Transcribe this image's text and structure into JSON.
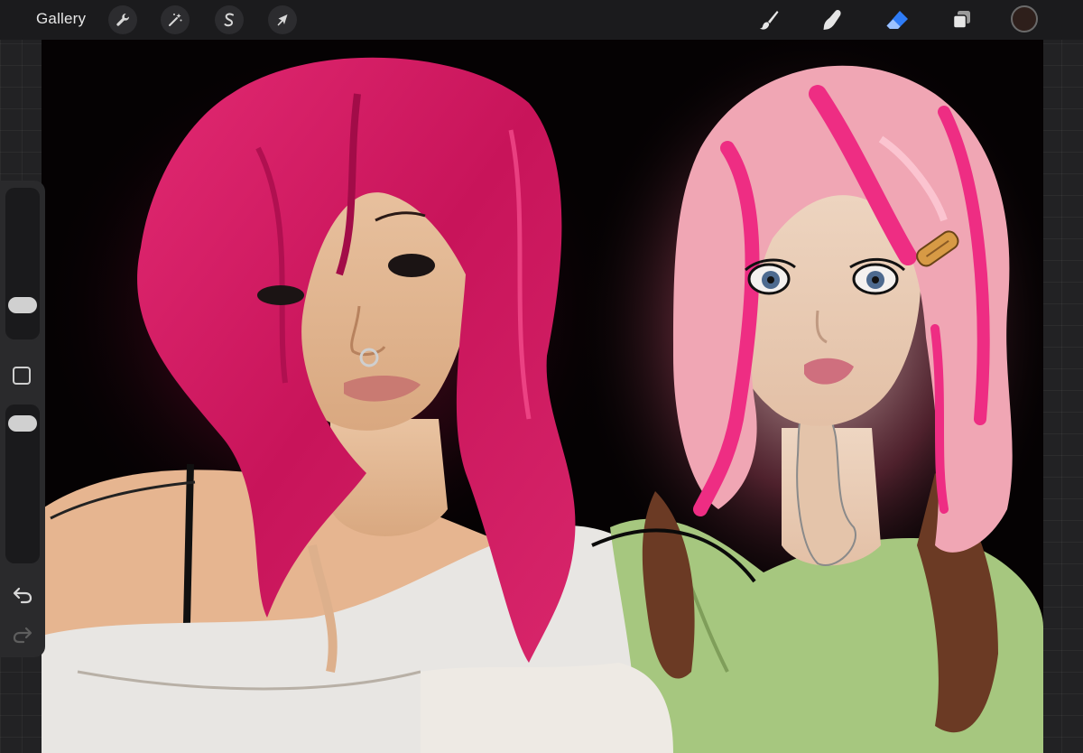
{
  "topbar": {
    "gallery_label": "Gallery",
    "actions_icon": "wrench-icon",
    "adjustments_icon": "magic-wand-icon",
    "selection_icon": "selection-s-icon",
    "transform_icon": "arrow-cursor-icon",
    "brush_icon": "brush-icon",
    "smudge_icon": "smudge-finger-icon",
    "eraser_icon": "eraser-icon",
    "layers_icon": "layers-icon",
    "active_tool": "eraser",
    "active_color": "#2e1f1b",
    "accent_color": "#2f7cf6"
  },
  "sidebar": {
    "brush_size_level": 0.18,
    "opacity_level": 0.06,
    "undo_icon": "undo-icon",
    "redo_icon": "redo-icon",
    "modify_icon": "square-modify-icon"
  },
  "canvas": {
    "background": "#050203",
    "left_hair_color": "#d41c62",
    "right_hair_pink": "#f0a6b4",
    "right_hair_magenta": "#ee2d83",
    "right_hair_brown": "#6b3a24",
    "skin_tone": "#eac3a0",
    "top_left_color": "#e8e6e3",
    "top_right_color": "#a6c77f",
    "hair_clip_color": "#d79a45"
  }
}
